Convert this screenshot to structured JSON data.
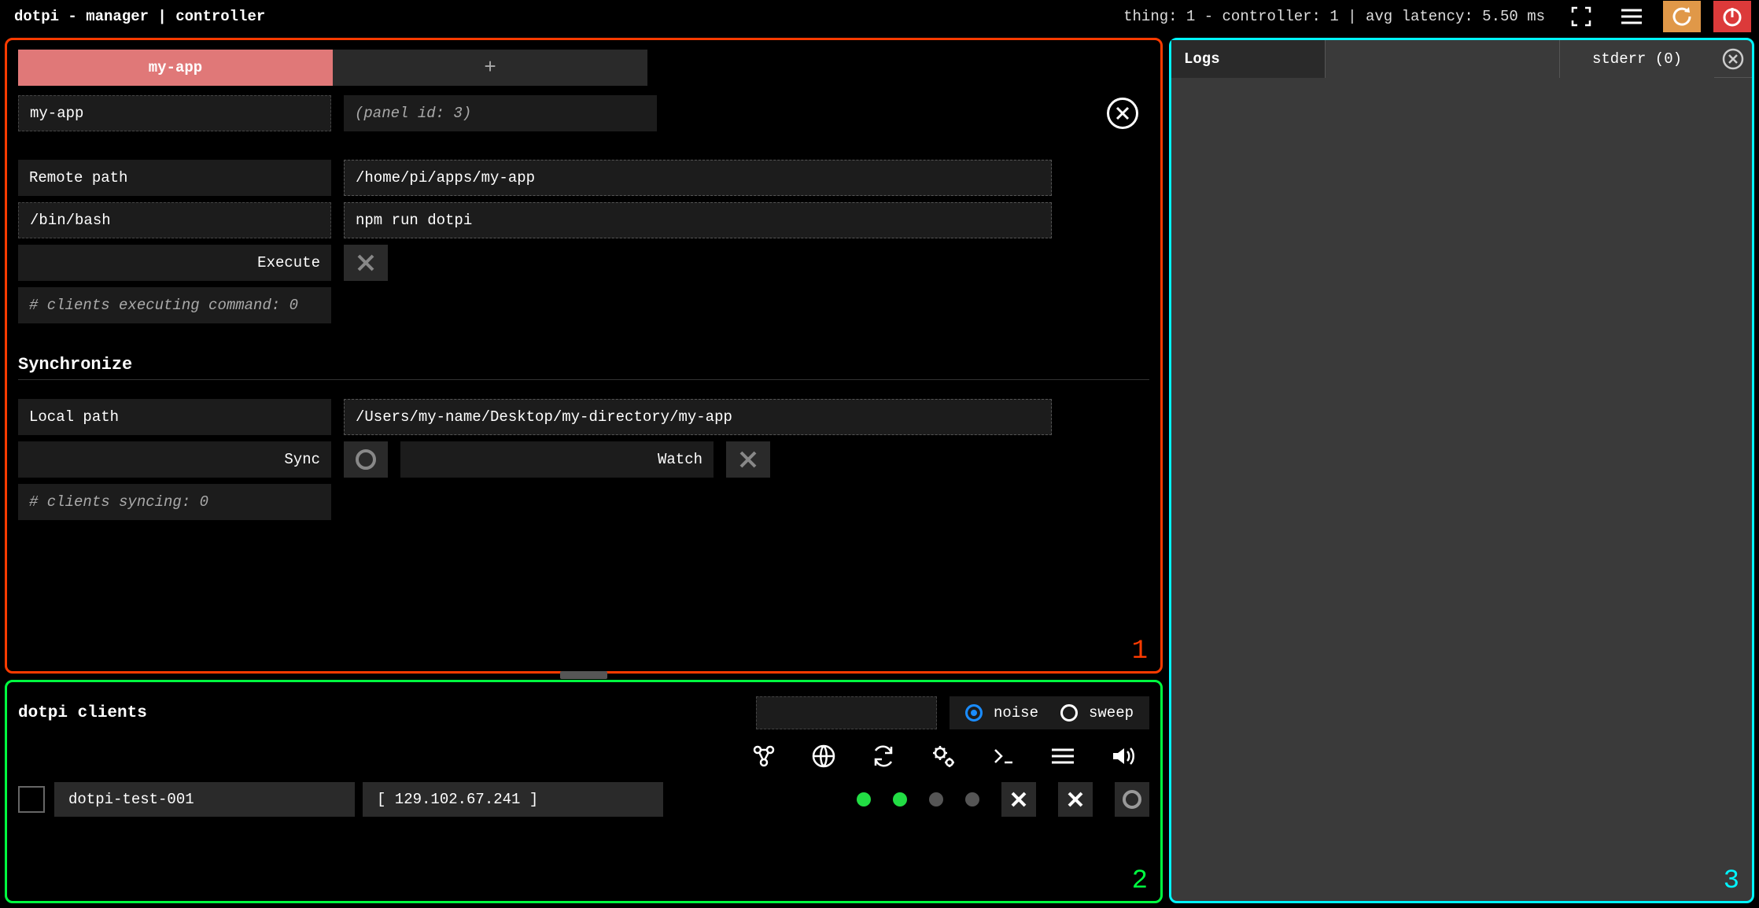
{
  "header": {
    "title": "dotpi - manager | controller",
    "stats": "thing:  1 - controller:  1 | avg latency:  5.50 ms"
  },
  "panel1": {
    "tab_active": "my-app",
    "tab_plus": "+",
    "name_value": "my-app",
    "panel_id_text": "(panel id: 3)",
    "remote_path_label": "Remote path",
    "remote_path_value": "/home/pi/apps/my-app",
    "shell_value": "/bin/bash",
    "command_value": "npm run dotpi",
    "execute_label": "Execute",
    "executing_status": "# clients executing command: 0",
    "sync_heading": "Synchronize",
    "local_path_label": "Local path",
    "local_path_value": "/Users/my-name/Desktop/my-directory/my-app",
    "sync_label": "Sync",
    "watch_label": "Watch",
    "syncing_status": "# clients syncing: 0",
    "num": "1"
  },
  "panel2": {
    "title": "dotpi clients",
    "radio_noise": "noise",
    "radio_sweep": "sweep",
    "client_name": "dotpi-test-001",
    "client_ip": "[ 129.102.67.241 ]",
    "num": "2"
  },
  "panel3": {
    "logs_label": "Logs",
    "stderr_label": "stderr (0)",
    "num": "3"
  }
}
